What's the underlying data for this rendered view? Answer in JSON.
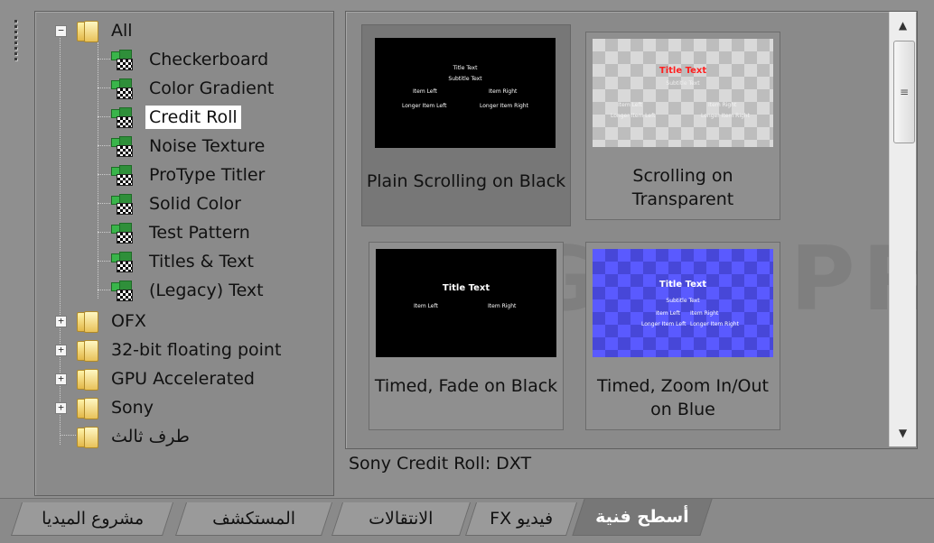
{
  "tree": {
    "root": "All",
    "children": [
      "Checkerboard",
      "Color Gradient",
      "Credit Roll",
      "Noise Texture",
      "ProType Titler",
      "Solid Color",
      "Test Pattern",
      "Titles & Text",
      "(Legacy) Text"
    ],
    "selected": "Credit Roll",
    "folders": [
      "OFX",
      "32-bit floating point",
      "GPU Accelerated",
      "Sony",
      "طرف ثالث"
    ]
  },
  "presets": [
    {
      "caption": "Plain Scrolling on Black",
      "thumb_lines": [
        "Title Text",
        "Subtitle Text",
        "Item Left",
        "Item Right",
        "Longer Item Left",
        "Longer Item Right"
      ]
    },
    {
      "caption": "Scrolling on Transparent",
      "thumb_lines": [
        "Title Text",
        "Subtitle Text",
        "Item Left",
        "Item Right",
        "Longer Item Left",
        "Longer Item Right"
      ]
    },
    {
      "caption": "Timed, Fade on Black",
      "thumb_lines": [
        "Title Text",
        "Item Left",
        "Item Right"
      ]
    },
    {
      "caption": "Timed, Zoom In/Out on Blue",
      "thumb_lines": [
        "Title Text",
        "Subtitle Text",
        "Item Left",
        "Item Right",
        "Longer Item Left",
        "Longer Item Right"
      ]
    }
  ],
  "selected_preset": "Plain Scrolling on Black",
  "description": "Sony Credit Roll: DXT",
  "watermark": "VEGAS PRO",
  "tabs": [
    "مشروع الميديا",
    "المستكشف",
    "الانتقالات",
    "فيديو FX",
    "أسطح فنية"
  ],
  "active_tab": "أسطح فنية",
  "colors": {
    "background": "#8f8f8f",
    "selected_tile": "#777777",
    "blue_thumb": "#5a5aff",
    "title_red": "#ff2020"
  }
}
